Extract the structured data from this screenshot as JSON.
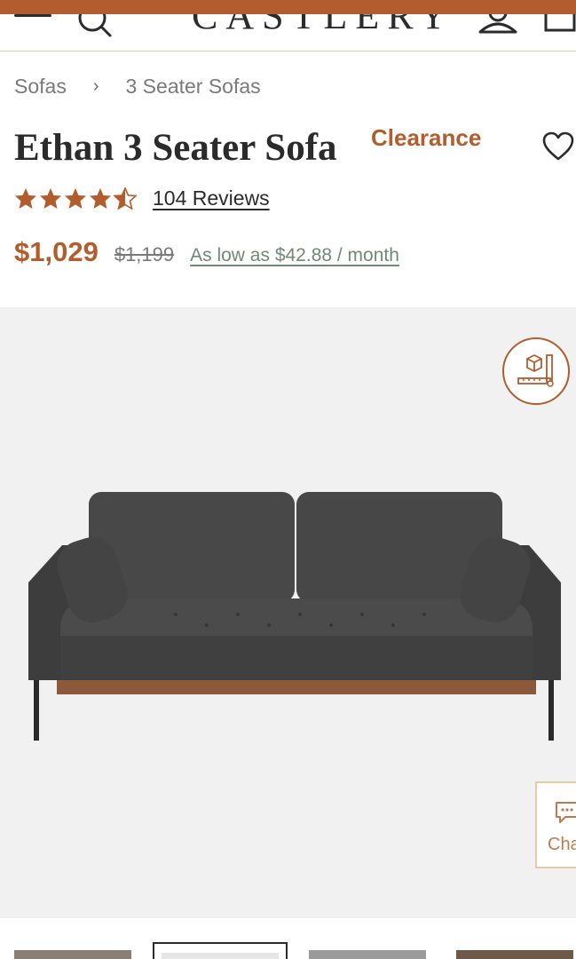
{
  "header": {
    "logo_text": "CASTLERY",
    "accent_color": "#b35c2e"
  },
  "breadcrumb": {
    "items": [
      "Sofas",
      "3 Seater Sofas"
    ],
    "separator": "›"
  },
  "product": {
    "title": "Ethan 3 Seater Sofa",
    "badge": "Clearance",
    "rating": 4.5,
    "rating_max": 5,
    "reviews_label": "104 Reviews",
    "price": "$1,029",
    "original_price": "$1,199",
    "installment_text": "As low as $42.88  / month"
  },
  "gallery": {
    "image_alt": "Ethan 3 Seater Sofa in dark grey with walnut base",
    "dimensions_icon": "ruler-box-icon",
    "thumbnail_count": 4,
    "active_thumbnail": 2
  },
  "chat": {
    "label": "Chat"
  },
  "icons": {
    "menu": "menu-icon",
    "search": "search-icon",
    "account": "account-icon",
    "cart": "cart-icon",
    "wishlist": "heart-icon",
    "star": "star-icon",
    "chat": "chat-icon"
  }
}
